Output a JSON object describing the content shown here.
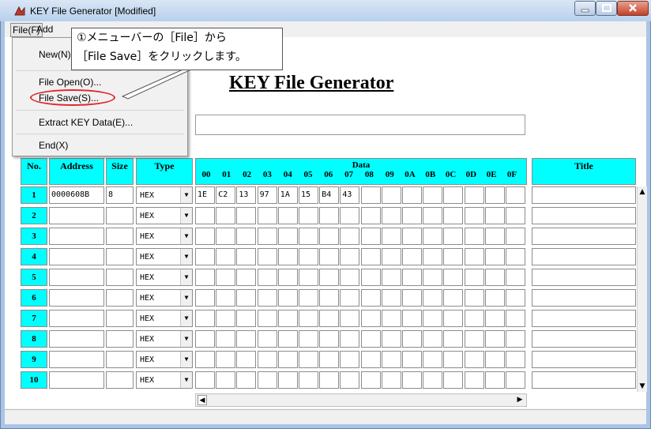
{
  "window": {
    "title": "KEY File Generator [Modified]"
  },
  "menubar": {
    "file": "File(F)",
    "add": "Add"
  },
  "file_menu": {
    "items": [
      "New(N)",
      "File Open(O)...",
      "File Save(S)...",
      "Extract KEY Data(E)...",
      "End(X)"
    ]
  },
  "callout": {
    "line1": "①メニューバーの［File］から",
    "line2": "［File Save］をクリックします。"
  },
  "form": {
    "heading": "KEY File Generator",
    "title_value": ""
  },
  "table": {
    "headers": {
      "no": "No.",
      "address": "Address",
      "size": "Size",
      "type": "Type",
      "data": "Data",
      "title": "Title"
    },
    "byte_columns": [
      "00",
      "01",
      "02",
      "03",
      "04",
      "05",
      "06",
      "07",
      "08",
      "09",
      "0A",
      "0B",
      "0C",
      "0D",
      "0E",
      "0F"
    ],
    "rows": [
      {
        "no": "1",
        "address": "0000608B",
        "size": "8",
        "type": "HEX",
        "data": [
          "1E",
          "C2",
          "13",
          "97",
          "1A",
          "15",
          "B4",
          "43",
          "",
          "",
          "",
          "",
          "",
          "",
          "",
          ""
        ],
        "title": ""
      },
      {
        "no": "2",
        "address": "",
        "size": "",
        "type": "HEX",
        "data": [
          "",
          "",
          "",
          "",
          "",
          "",
          "",
          "",
          "",
          "",
          "",
          "",
          "",
          "",
          "",
          ""
        ],
        "title": ""
      },
      {
        "no": "3",
        "address": "",
        "size": "",
        "type": "HEX",
        "data": [
          "",
          "",
          "",
          "",
          "",
          "",
          "",
          "",
          "",
          "",
          "",
          "",
          "",
          "",
          "",
          ""
        ],
        "title": ""
      },
      {
        "no": "4",
        "address": "",
        "size": "",
        "type": "HEX",
        "data": [
          "",
          "",
          "",
          "",
          "",
          "",
          "",
          "",
          "",
          "",
          "",
          "",
          "",
          "",
          "",
          ""
        ],
        "title": ""
      },
      {
        "no": "5",
        "address": "",
        "size": "",
        "type": "HEX",
        "data": [
          "",
          "",
          "",
          "",
          "",
          "",
          "",
          "",
          "",
          "",
          "",
          "",
          "",
          "",
          "",
          ""
        ],
        "title": ""
      },
      {
        "no": "6",
        "address": "",
        "size": "",
        "type": "HEX",
        "data": [
          "",
          "",
          "",
          "",
          "",
          "",
          "",
          "",
          "",
          "",
          "",
          "",
          "",
          "",
          "",
          ""
        ],
        "title": ""
      },
      {
        "no": "7",
        "address": "",
        "size": "",
        "type": "HEX",
        "data": [
          "",
          "",
          "",
          "",
          "",
          "",
          "",
          "",
          "",
          "",
          "",
          "",
          "",
          "",
          "",
          ""
        ],
        "title": ""
      },
      {
        "no": "8",
        "address": "",
        "size": "",
        "type": "HEX",
        "data": [
          "",
          "",
          "",
          "",
          "",
          "",
          "",
          "",
          "",
          "",
          "",
          "",
          "",
          "",
          "",
          ""
        ],
        "title": ""
      },
      {
        "no": "9",
        "address": "",
        "size": "",
        "type": "HEX",
        "data": [
          "",
          "",
          "",
          "",
          "",
          "",
          "",
          "",
          "",
          "",
          "",
          "",
          "",
          "",
          "",
          ""
        ],
        "title": ""
      },
      {
        "no": "10",
        "address": "",
        "size": "",
        "type": "HEX",
        "data": [
          "",
          "",
          "",
          "",
          "",
          "",
          "",
          "",
          "",
          "",
          "",
          "",
          "",
          "",
          "",
          ""
        ],
        "title": ""
      }
    ]
  },
  "colors": {
    "header_bg": "#00ffff",
    "highlight_oval": "#e0262a"
  }
}
